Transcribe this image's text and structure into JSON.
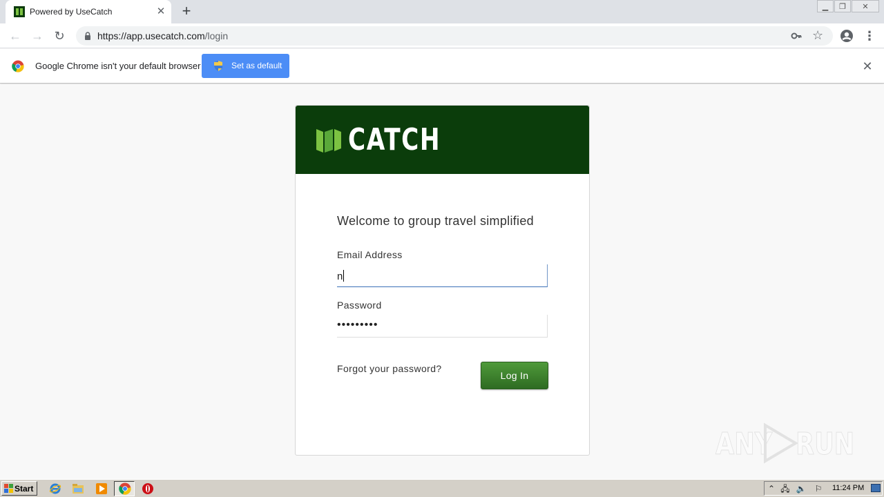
{
  "browser": {
    "tab": {
      "title": "Powered by UseCatch"
    },
    "url": {
      "host": "https://app.usecatch.com",
      "path": "/login"
    },
    "infobar": {
      "message": "Google Chrome isn't your default browser",
      "button_label": "Set as default"
    }
  },
  "page": {
    "brand": "CATCH",
    "welcome": "Welcome to group travel simplified",
    "email": {
      "label": "Email Address",
      "value": "n"
    },
    "password": {
      "label": "Password",
      "masked_value": "•••••••••"
    },
    "forgot_link": "Forgot your password?",
    "login_button": "Log In"
  },
  "watermark": {
    "left": "ANY",
    "right": "RUN"
  },
  "taskbar": {
    "start_label": "Start",
    "clock": "11:24 PM",
    "pinned": [
      "ie-icon",
      "explorer-icon",
      "media-player-icon",
      "chrome-icon",
      "opera-icon"
    ]
  },
  "colors": {
    "brand_dark_green": "#0b3d0b",
    "login_button": "#3f8530",
    "infobar_button": "#4c8df6"
  }
}
